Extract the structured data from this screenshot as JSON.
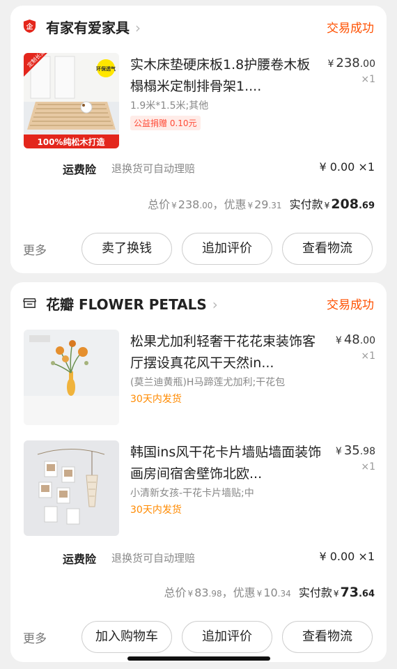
{
  "orders": [
    {
      "shop_name": "有家有爱家具",
      "shop_icon": "tmall-badge-icon",
      "status": "交易成功",
      "items": [
        {
          "title": "实木床垫硬床板1.8护腰卷木板榻榻米定制排骨架1....",
          "price_currency": "¥",
          "price_int": "238",
          "price_dec": ".00",
          "qty": "×1",
          "sku": "1.9米*1.5米;其他",
          "tag": "公益捐赠 0.10元",
          "thumb_label": "100%纯松木打造",
          "thumb_corner": "定制长宽",
          "thumb_badge": "环保透气"
        }
      ],
      "insurance": {
        "label": "运费险",
        "desc": "退换货可自动理赔",
        "price": "¥ 0.00 ×1"
      },
      "total": {
        "total_label": "总价",
        "total_cur": "¥",
        "total_int": "238",
        "total_dec": ".00",
        "comma": "，",
        "discount_label": "优惠",
        "discount_cur": "¥",
        "discount_int": "29",
        "discount_dec": ".31",
        "paid_label": "实付款",
        "paid_cur": "¥",
        "paid_int": "208",
        "paid_dec": ".69"
      },
      "more": "更多",
      "buttons": [
        "卖了换钱",
        "追加评价",
        "查看物流"
      ]
    },
    {
      "shop_name": "花瓣 FLOWER PETALS",
      "shop_icon": "store-icon",
      "status": "交易成功",
      "items": [
        {
          "title": "松果尤加利轻奢干花花束装饰客厅摆设真花风干天然in...",
          "price_currency": "¥",
          "price_int": "48",
          "price_dec": ".00",
          "qty": "×1",
          "sku": "(莫兰迪黄瓶)H马蹄莲尤加利;干花包",
          "tag": "30天内发货"
        },
        {
          "title": "韩国ins风干花卡片墙贴墙面装饰画房间宿舍壁饰北欧...",
          "price_currency": "¥",
          "price_int": "35",
          "price_dec": ".98",
          "qty": "×1",
          "sku": "小清新女孩-干花卡片墙贴;中",
          "tag": "30天内发货"
        }
      ],
      "insurance": {
        "label": "运费险",
        "desc": "退换货可自动理赔",
        "price": "¥ 0.00 ×1"
      },
      "total": {
        "total_label": "总价",
        "total_cur": "¥",
        "total_int": "83",
        "total_dec": ".98",
        "comma": "，",
        "discount_label": "优惠",
        "discount_cur": "¥",
        "discount_int": "10",
        "discount_dec": ".34",
        "paid_label": "实付款",
        "paid_cur": "¥",
        "paid_int": "73",
        "paid_dec": ".64"
      },
      "more": "更多",
      "buttons": [
        "加入购物车",
        "追加评价",
        "查看物流"
      ]
    }
  ],
  "colors": {
    "accent": "#ff5000",
    "tag_red": "#ff4a36",
    "tag_orange": "#ff8a00",
    "background": "#f0f0f0"
  }
}
